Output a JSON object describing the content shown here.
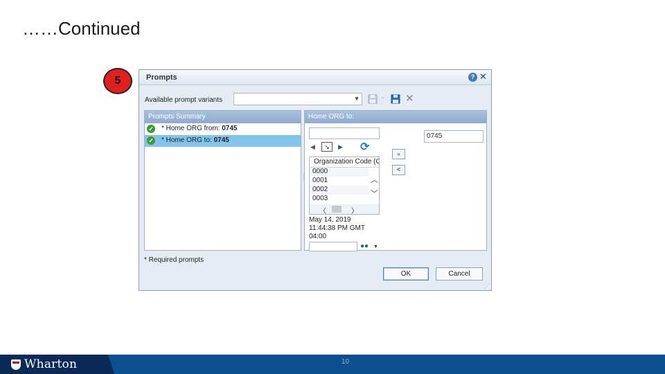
{
  "slide": {
    "title": "……Continued",
    "step_number": "5",
    "page_number": "10",
    "logo_text": "Wharton"
  },
  "dialog": {
    "title": "Prompts",
    "help_glyph": "?",
    "close_glyph": "✕",
    "variants_label": "Available prompt variants",
    "variants_value": "",
    "summary": {
      "header": "Prompts Summary",
      "items": [
        {
          "label": "* Home ORG from: ",
          "value": "0745",
          "selected": false
        },
        {
          "label": "* Home ORG to: ",
          "value": "0745",
          "selected": true
        }
      ]
    },
    "right": {
      "header": "Home ORG to:",
      "search_value": "",
      "selected_value": "0745",
      "list_header": "Organization Code (C",
      "list_items": [
        "0000",
        "0001",
        "0002",
        "0003"
      ],
      "refresh_timestamp": "May 14, 2019 11:44:38 PM GMT 04:00"
    },
    "required_note": "* Required prompts",
    "ok_label": "OK",
    "cancel_label": "Cancel"
  },
  "icons": {
    "check": "check-circle-icon",
    "refresh": "refresh-icon",
    "search": "binoculars-icon",
    "save": "save-icon",
    "delete": "delete-icon"
  },
  "colors": {
    "badge": "#e02020",
    "selected_row": "#82c4ea",
    "panel_header": "#8eaad0",
    "footer": "#0b4f8f",
    "footer_logo_bg": "#0b2a57"
  }
}
